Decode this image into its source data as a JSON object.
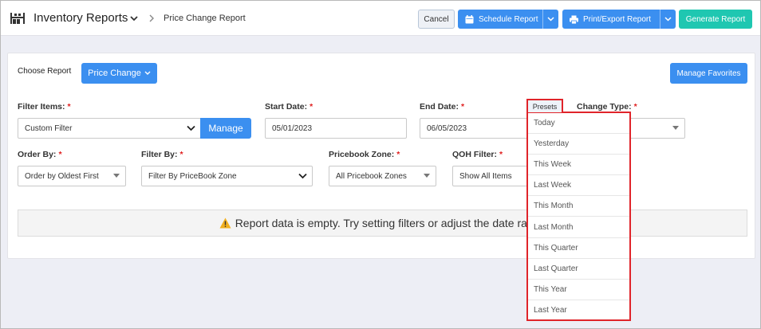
{
  "header": {
    "app_title": "Inventory Reports",
    "breadcrumb_current": "Price Change Report",
    "cancel_label": "Cancel",
    "schedule_label": "Schedule Report",
    "print_label": "Print/Export Report",
    "generate_label": "Generate Report"
  },
  "report": {
    "choose_label": "Choose Report",
    "selected_report": "Price Change",
    "manage_favorites_label": "Manage Favorites"
  },
  "filters": {
    "filter_items": {
      "label": "Filter Items:",
      "value": "Custom Filter",
      "manage_label": "Manage"
    },
    "start_date": {
      "label": "Start Date:",
      "value": "05/01/2023"
    },
    "end_date": {
      "label": "End Date:",
      "value": "06/05/2023"
    },
    "change_type": {
      "label": "Change Type:"
    },
    "order_by": {
      "label": "Order By:",
      "value": "Order by Oldest First"
    },
    "filter_by": {
      "label": "Filter By:",
      "value": "Filter By PriceBook Zone"
    },
    "pricebook_zone": {
      "label": "Pricebook Zone:",
      "value": "All Pricebook Zones"
    },
    "qoh_filter": {
      "label": "QOH Filter:",
      "value": "Show All Items"
    },
    "required_marker": "*"
  },
  "empty_message": "Report data is empty. Try setting filters or adjust the date range",
  "presets": {
    "tab_label": "Presets",
    "items": [
      "Today",
      "Yesterday",
      "This Week",
      "Last Week",
      "This Month",
      "Last Month",
      "This Quarter",
      "Last Quarter",
      "This Year",
      "Last Year"
    ]
  },
  "colors": {
    "primary": "#3b8ff0",
    "teal": "#1fc7b1",
    "highlight": "#e0242a",
    "required": "#e02020"
  }
}
